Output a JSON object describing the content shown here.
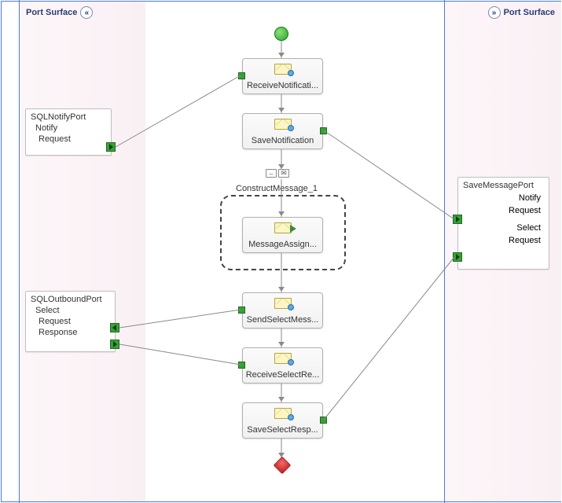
{
  "panels": {
    "left_title": "Port Surface",
    "right_title": "Port Surface"
  },
  "left_ports": {
    "notify": {
      "name": "SQLNotifyPort",
      "operation": "Notify",
      "message": "Request"
    },
    "outbound": {
      "name": "SQLOutboundPort",
      "operation": "Select",
      "request": "Request",
      "response": "Response"
    }
  },
  "right_ports": {
    "save": {
      "name": "SaveMessagePort",
      "op1": "Notify",
      "msg1": "Request",
      "op2": "Select",
      "msg2": "Request"
    }
  },
  "shapes": {
    "receive_notification": "ReceiveNotificati...",
    "save_notification": "SaveNotification",
    "construct_label": "ConstructMessage_1",
    "message_assign": "MessageAssign...",
    "send_select": "SendSelectMess...",
    "receive_select": "ReceiveSelectRe...",
    "save_select": "SaveSelectResp..."
  }
}
